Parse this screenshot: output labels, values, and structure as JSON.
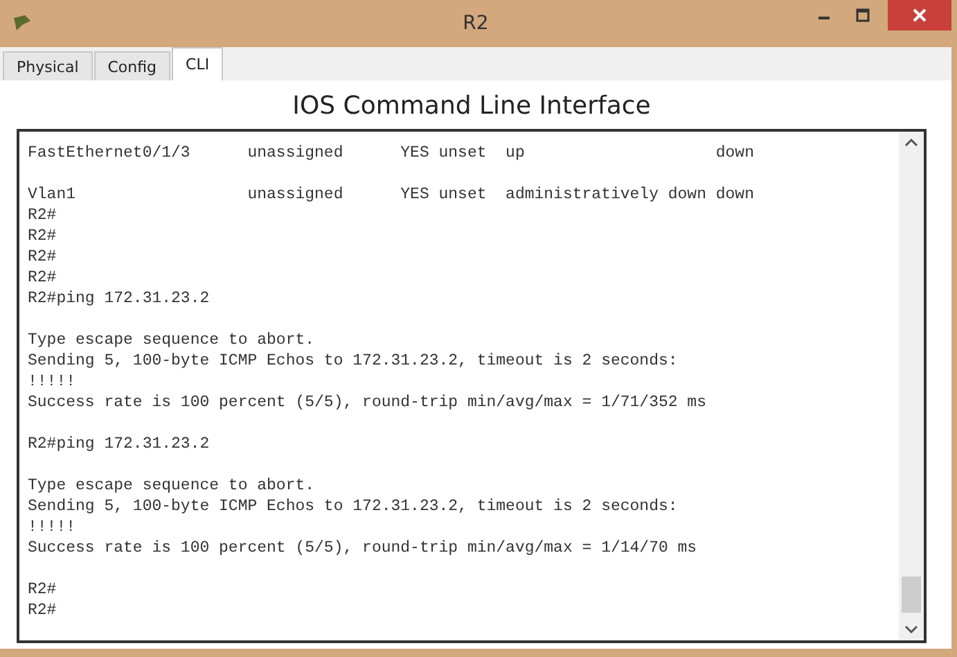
{
  "window": {
    "title": "R2"
  },
  "tabs": [
    {
      "label": "Physical",
      "selected": false
    },
    {
      "label": "Config",
      "selected": false
    },
    {
      "label": "CLI",
      "selected": true
    }
  ],
  "heading": "IOS Command Line Interface",
  "terminal": {
    "blocks": [
      [
        "FastEthernet0/1/3      unassigned      YES unset  up                    down"
      ],
      [
        "Vlan1                  unassigned      YES unset  administratively down down",
        "R2#",
        "R2#",
        "R2#",
        "R2#",
        "R2#ping 172.31.23.2"
      ],
      [
        "Type escape sequence to abort.",
        "Sending 5, 100-byte ICMP Echos to 172.31.23.2, timeout is 2 seconds:",
        "!!!!!",
        "Success rate is 100 percent (5/5), round-trip min/avg/max = 1/71/352 ms"
      ],
      [
        "R2#ping 172.31.23.2"
      ],
      [
        "Type escape sequence to abort.",
        "Sending 5, 100-byte ICMP Echos to 172.31.23.2, timeout is 2 seconds:",
        "!!!!!",
        "Success rate is 100 percent (5/5), round-trip min/avg/max = 1/14/70 ms"
      ],
      [
        "R2#",
        "R2#"
      ]
    ]
  }
}
